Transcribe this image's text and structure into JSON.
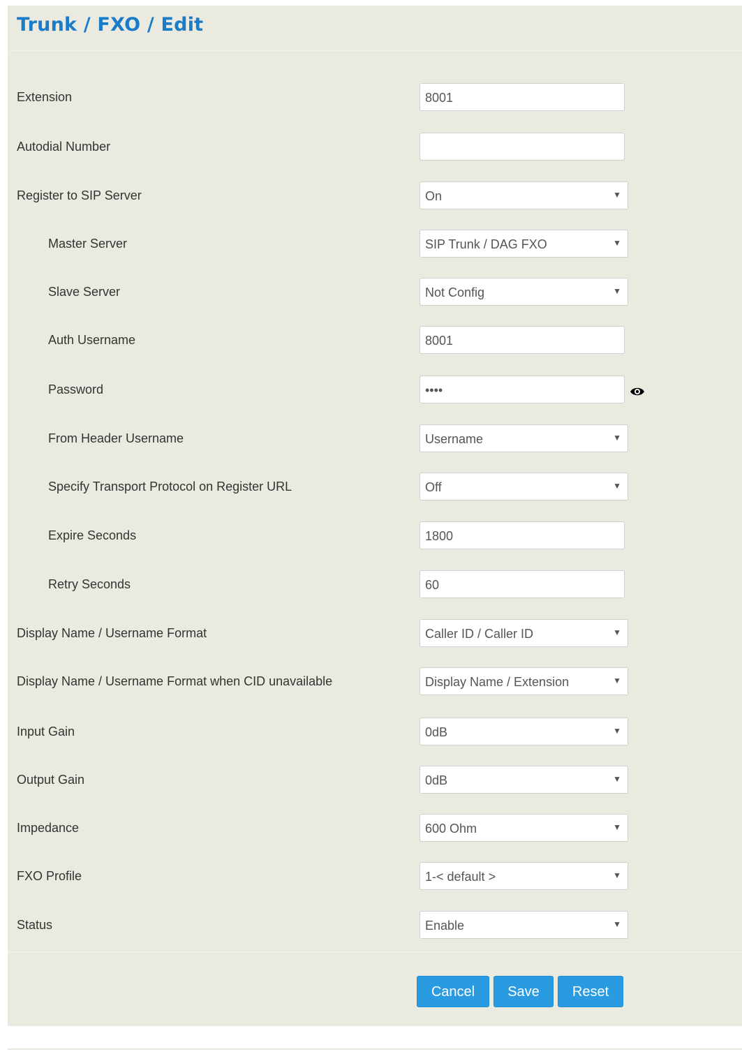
{
  "page": {
    "title": "Trunk / FXO / Edit"
  },
  "fields": {
    "extension": {
      "label": "Extension",
      "value": "8001"
    },
    "autodial": {
      "label": "Autodial Number",
      "value": ""
    },
    "register_sip": {
      "label": "Register to SIP Server",
      "value": "On"
    },
    "master_server": {
      "label": "Master Server",
      "value": "SIP Trunk / DAG FXO"
    },
    "slave_server": {
      "label": "Slave Server",
      "value": "Not Config"
    },
    "auth_username": {
      "label": "Auth Username",
      "value": "8001"
    },
    "password": {
      "label": "Password",
      "value": "••••"
    },
    "from_header": {
      "label": "From Header Username",
      "value": "Username"
    },
    "transport_proto": {
      "label": "Specify Transport Protocol on Register URL",
      "value": "Off"
    },
    "expire_seconds": {
      "label": "Expire Seconds",
      "value": "1800"
    },
    "retry_seconds": {
      "label": "Retry Seconds",
      "value": "60"
    },
    "display_format": {
      "label": "Display Name / Username Format",
      "value": "Caller ID / Caller ID"
    },
    "display_format_cid": {
      "label": "Display Name / Username Format when CID unavailable",
      "value": "Display Name / Extension"
    },
    "input_gain": {
      "label": "Input Gain",
      "value": "0dB"
    },
    "output_gain": {
      "label": "Output Gain",
      "value": "0dB"
    },
    "impedance": {
      "label": "Impedance",
      "value": "600 Ohm"
    },
    "fxo_profile": {
      "label": "FXO Profile",
      "value": "1-< default >"
    },
    "status": {
      "label": "Status",
      "value": "Enable"
    }
  },
  "icons": {
    "dropdown": "caret-down-icon",
    "password_toggle": "eye-icon"
  },
  "buttons": {
    "cancel": "Cancel",
    "save": "Save",
    "reset": "Reset"
  },
  "colors": {
    "accent": "#2a9be0",
    "title": "#1a7bc9",
    "panel_bg": "#ebeae1"
  }
}
